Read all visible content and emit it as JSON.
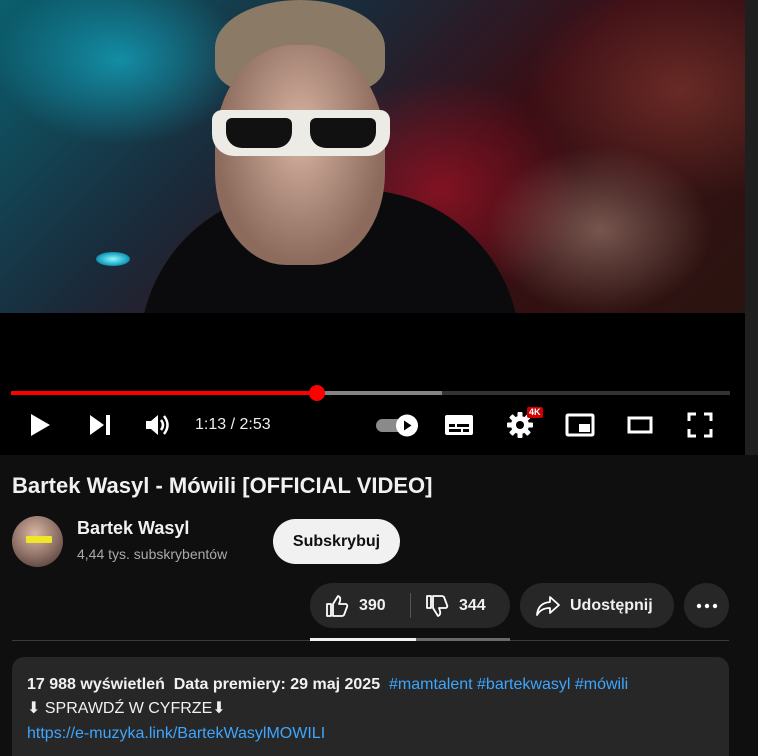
{
  "player": {
    "time_current": "1:13",
    "time_sep": " / ",
    "time_total": "2:53",
    "progress_played": 0.425,
    "progress_buffered": 0.6,
    "quality_badge": "4K"
  },
  "video": {
    "title": "Bartek Wasyl - Mówili [OFFICIAL VIDEO]"
  },
  "channel": {
    "name": "Bartek Wasyl",
    "subscribers": "4,44 tys. subskrybentów",
    "subscribe_label": "Subskrybuj"
  },
  "actions": {
    "likes": "390",
    "dislikes": "344",
    "share_label": "Udostępnij"
  },
  "description": {
    "views": "17 988 wyświetleń",
    "premiere": "Data premiery: 29 maj 2025",
    "hashtags": [
      "#mamtalent",
      "#bartekwasyl",
      "#mówili"
    ],
    "line2": "⬇ SPRAWDŹ W CYFRZE⬇",
    "link": "https://e-muzyka.link/BartekWasylMOWILI"
  },
  "colors": {
    "accent": "#ff0000",
    "link": "#3ea6ff",
    "background": "#0f0f0f",
    "pill": "#272727"
  }
}
